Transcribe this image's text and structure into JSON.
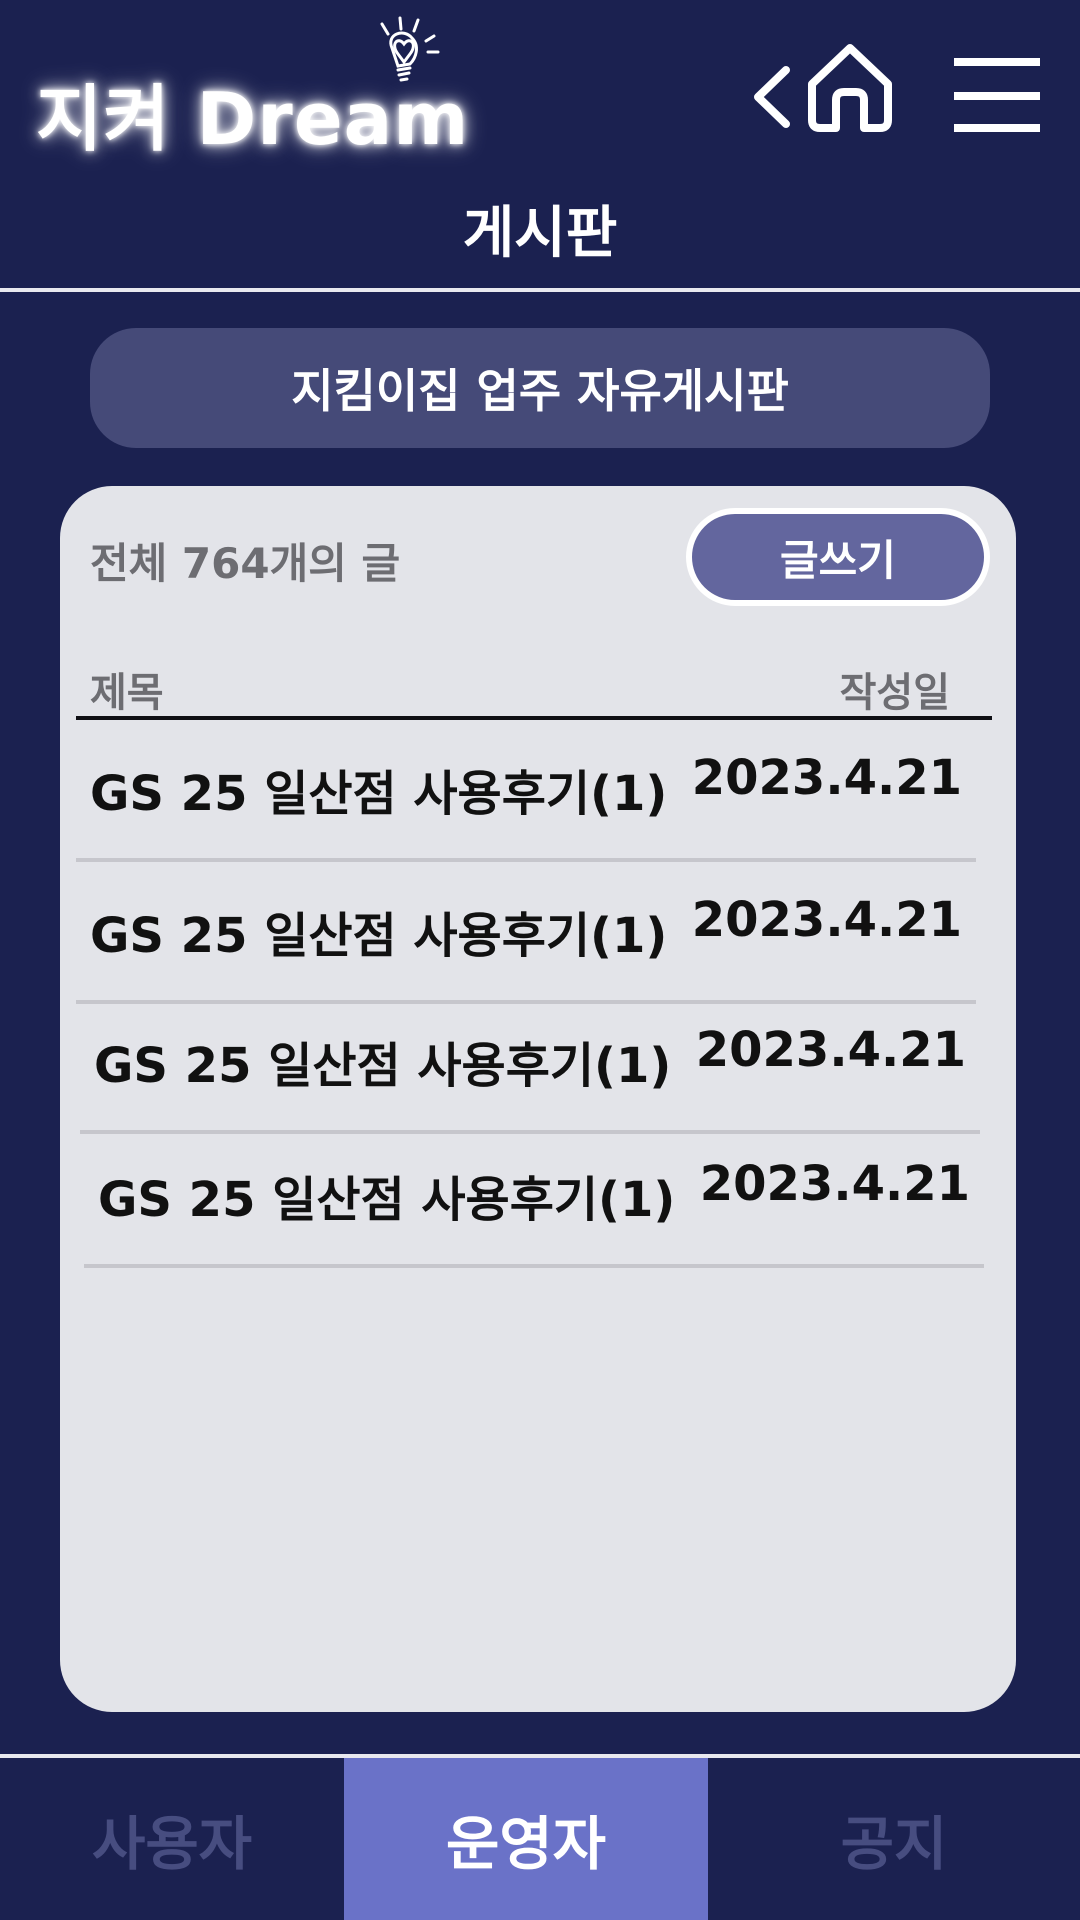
{
  "header": {
    "logo_text": "지켜 Dream",
    "page_title": "게시판"
  },
  "icons": {
    "logo": "lightbulb-heart-icon",
    "back": "chevron-left-icon",
    "home": "home-icon",
    "menu": "hamburger-menu-icon"
  },
  "board": {
    "name": "지킴이집 업주 자유게시판"
  },
  "list": {
    "count_label": "전체 764개의 글",
    "write_label": "글쓰기",
    "col_title": "제목",
    "col_date": "작성일",
    "posts": [
      {
        "title": "GS 25 일산점 사용후기(1)",
        "date": "2023.4.21"
      },
      {
        "title": "GS 25 일산점 사용후기(1)",
        "date": "2023.4.21"
      },
      {
        "title": "GS 25 일산점 사용후기(1)",
        "date": "2023.4.21"
      },
      {
        "title": "GS 25 일산점 사용후기(1)",
        "date": "2023.4.21"
      }
    ]
  },
  "nav": {
    "tabs": [
      {
        "label": "사용자"
      },
      {
        "label": "운영자"
      },
      {
        "label": "공지"
      }
    ],
    "active_index": 1
  },
  "colors": {
    "background": "#1b2150",
    "board_pill": "#454a78",
    "card": "#e3e4e9",
    "write_button": "#63669e",
    "nav_active": "#6a72c8",
    "nav_inactive_text": "#474d80"
  }
}
